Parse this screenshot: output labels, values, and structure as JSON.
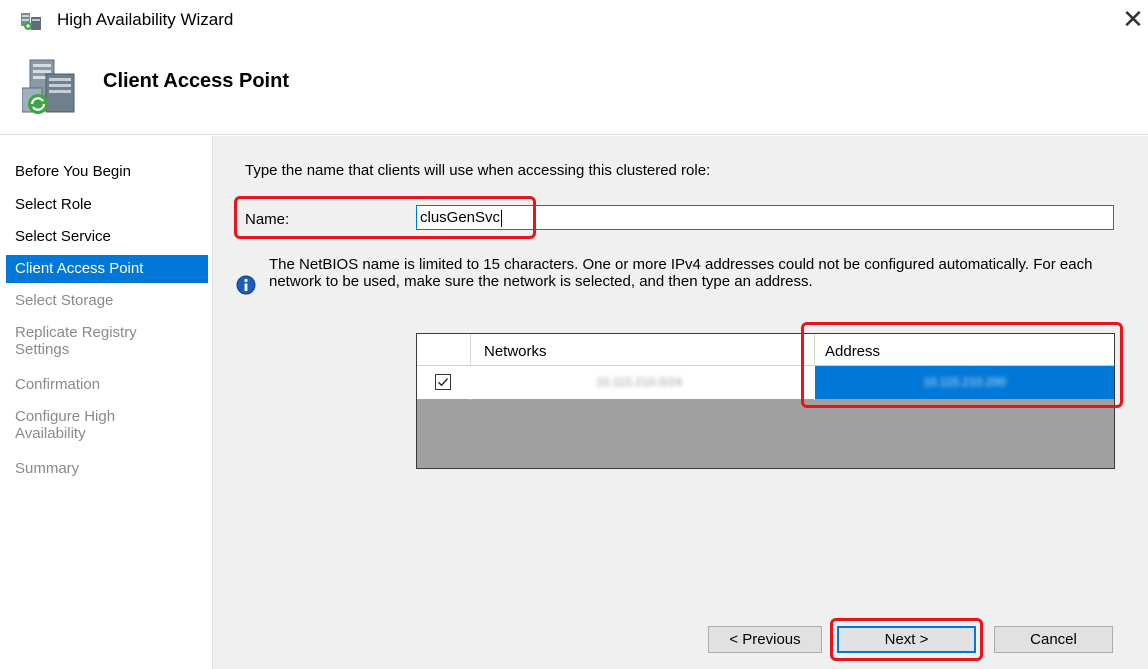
{
  "window": {
    "title": "High Availability Wizard",
    "close_glyph": "✕"
  },
  "page": {
    "title": "Client Access Point"
  },
  "nav": {
    "items": [
      {
        "label": "Before You Begin",
        "state": "completed"
      },
      {
        "label": "Select Role",
        "state": "completed"
      },
      {
        "label": "Select Service",
        "state": "completed"
      },
      {
        "label": "Client Access Point",
        "state": "active"
      },
      {
        "label": "Select Storage",
        "state": "disabled"
      },
      {
        "label": "Replicate Registry\nSettings",
        "state": "disabled"
      },
      {
        "label": "Confirmation",
        "state": "disabled"
      },
      {
        "label": "Configure High\nAvailability",
        "state": "disabled"
      },
      {
        "label": "Summary",
        "state": "disabled"
      }
    ]
  },
  "main": {
    "instruction": "Type the name that clients will use when accessing this clustered role:",
    "name_label": "Name:",
    "name_value": "clusGenSvc",
    "info_text": "The NetBIOS name is limited to 15 characters.  One or more IPv4 addresses could not be configured automatically.  For each network to be used, make sure the network is selected, and then type an address.",
    "grid": {
      "columns": [
        "",
        "Networks",
        "Address"
      ],
      "rows": [
        {
          "checked": true,
          "network": "10.115.210.0/24",
          "address": "10.115.210.200"
        }
      ]
    }
  },
  "buttons": {
    "previous": "< Previous",
    "next": "Next >",
    "cancel": "Cancel"
  },
  "colors": {
    "accent": "#0078d7",
    "highlight": "#e8151b",
    "panel": "#f0f0f0"
  }
}
